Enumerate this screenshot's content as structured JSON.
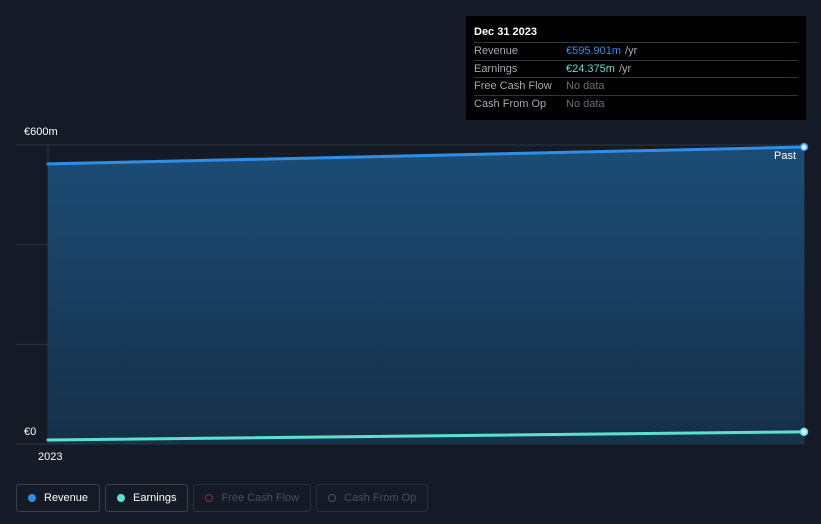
{
  "tooltip": {
    "date": "Dec 31 2023",
    "rows": [
      {
        "name": "Revenue",
        "value": "€595.901m",
        "unit": "/yr",
        "color": "#2f8fe6"
      },
      {
        "name": "Earnings",
        "value": "€24.375m",
        "unit": "/yr",
        "color": "#5ce0d0"
      },
      {
        "name": "Free Cash Flow",
        "value": "No data",
        "unit": "",
        "color": "#6b7079"
      },
      {
        "name": "Cash From Op",
        "value": "No data",
        "unit": "",
        "color": "#6b7079"
      }
    ]
  },
  "legend": [
    {
      "label": "Revenue",
      "color": "#2f8fe6",
      "active": true
    },
    {
      "label": "Earnings",
      "color": "#5ce0d0",
      "active": true
    },
    {
      "label": "Free Cash Flow",
      "color": "#8a2d45",
      "active": false
    },
    {
      "label": "Cash From Op",
      "color": "#4f545e",
      "active": false
    }
  ],
  "chart_data": {
    "type": "area",
    "y_tick_labels": [
      "€600m",
      "€0"
    ],
    "x_tick_labels": [
      "2023"
    ],
    "annotation": "Past",
    "ylim": [
      0,
      600
    ],
    "x": [
      "2023-01-01",
      "2023-12-31"
    ],
    "series": [
      {
        "name": "Revenue",
        "color": "#2f8fe6",
        "values": [
          562,
          595.901
        ]
      },
      {
        "name": "Earnings",
        "color": "#5ce0d0",
        "values": [
          8,
          24.375
        ]
      }
    ],
    "grid": true
  }
}
